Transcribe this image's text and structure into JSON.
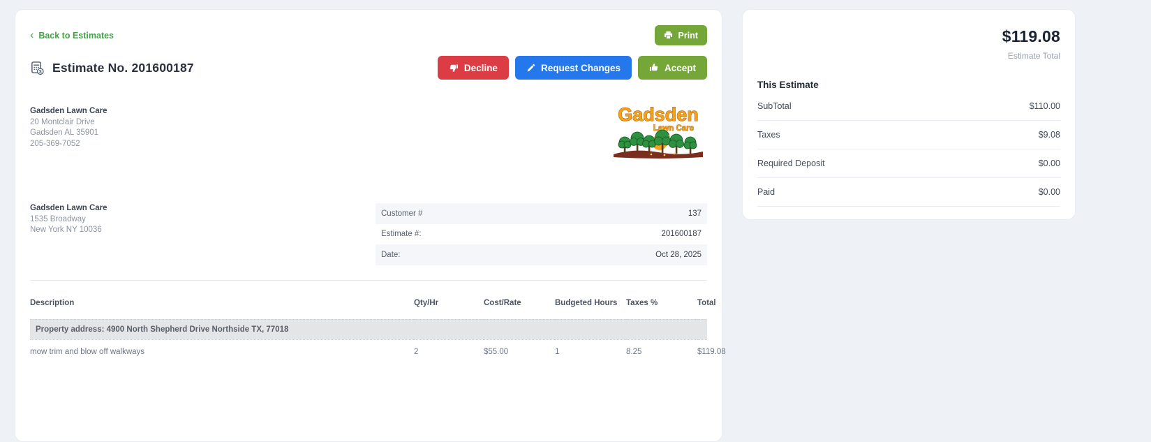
{
  "toolbar": {
    "back_label": "Back to Estimates",
    "print_label": "Print"
  },
  "header": {
    "title": "Estimate No. 201600187",
    "decline_label": "Decline",
    "request_changes_label": "Request Changes",
    "accept_label": "Accept"
  },
  "company": {
    "name": "Gadsden Lawn Care",
    "address_line1": "20 Montclair Drive",
    "address_line2": "Gadsden AL 35901",
    "phone": "205-369-7052"
  },
  "logo": {
    "line1": "Gadsden",
    "line2": "Lawn Care"
  },
  "customer": {
    "name": "Gadsden Lawn Care",
    "address_line1": "1535 Broadway",
    "address_line2": "New York NY 10036"
  },
  "meta": {
    "rows": [
      {
        "label": "Customer #",
        "value": "137"
      },
      {
        "label": "Estimate #:",
        "value": "201600187"
      },
      {
        "label": "Date:",
        "value": "Oct 28, 2025"
      }
    ]
  },
  "items_table": {
    "headers": [
      "Description",
      "Qty/Hr",
      "Cost/Rate",
      "Budgeted Hours",
      "Taxes %",
      "Total"
    ],
    "property_row": "Property address: 4900 North Shepherd Drive Northside TX, 77018",
    "rows": [
      {
        "description": "mow trim and blow off walkways",
        "qty": "2",
        "cost_rate": "$55.00",
        "budgeted_hours": "1",
        "taxes_pct": "8.25",
        "total": "$119.08"
      }
    ]
  },
  "summary": {
    "total": "$119.08",
    "total_caption": "Estimate Total",
    "section_title": "This Estimate",
    "rows": [
      {
        "label": "SubTotal",
        "value": "$110.00"
      },
      {
        "label": "Taxes",
        "value": "$9.08"
      },
      {
        "label": "Required Deposit",
        "value": "$0.00"
      },
      {
        "label": "Paid",
        "value": "$0.00"
      }
    ]
  },
  "colors": {
    "accent_green": "#74a737",
    "link_green": "#45a049",
    "danger_red": "#dc3d45",
    "primary_blue": "#2577ec",
    "logo_orange": "#f6a01d",
    "page_background": "#eef1f6"
  }
}
